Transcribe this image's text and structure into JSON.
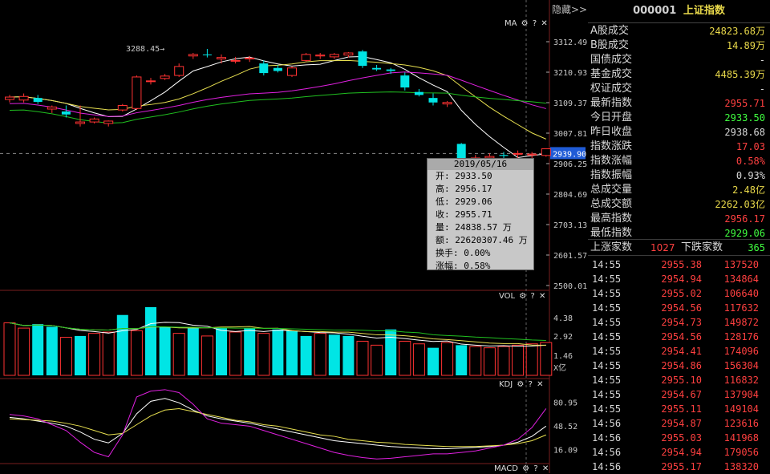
{
  "header": {
    "code": "000001",
    "name": "上证指数",
    "hide_label": "隐藏>>"
  },
  "ma_panel": {
    "label": "MA",
    "gear": "gear-icon",
    "help": "?",
    "close": "✕",
    "high_marker": "3288.45→",
    "price_ticks": [
      "3312.49",
      "3210.93",
      "3109.37",
      "3007.81",
      "2906.25",
      "2804.69",
      "2703.13",
      "2601.57",
      "2500.01"
    ],
    "current_price": "2939.90"
  },
  "vol_panel": {
    "label": "VOL",
    "ticks": [
      "4.38",
      "2.92",
      "1.46",
      "X亿"
    ]
  },
  "kdj_panel": {
    "label": "KDJ",
    "ticks": [
      "80.95",
      "48.52",
      "16.09"
    ]
  },
  "macd_panel": {
    "label": "MACD"
  },
  "tooltip": {
    "date": "2019/05/16",
    "lines": [
      "开: 2933.50",
      "高: 2956.17",
      "低: 2929.06",
      "收: 2955.71",
      "量: 24838.57 万",
      "额: 22620307.46 万",
      "换手: 0.00%",
      "涨幅: 0.58%"
    ]
  },
  "stats": [
    {
      "label": "A股成交",
      "value": "24823.68万",
      "color": "#e8d84a"
    },
    {
      "label": "B股成交",
      "value": "14.89万",
      "color": "#e8d84a"
    },
    {
      "label": "国债成交",
      "value": "-",
      "color": "#d8d8d8"
    },
    {
      "label": "基金成交",
      "value": "4485.39万",
      "color": "#e8d84a"
    },
    {
      "label": "权证成交",
      "value": "-",
      "color": "#d8d8d8"
    },
    {
      "label": "最新指数",
      "value": "2955.71",
      "color": "#ff4040"
    },
    {
      "label": "今日开盘",
      "value": "2933.50",
      "color": "#40ff40"
    },
    {
      "label": "昨日收盘",
      "value": "2938.68",
      "color": "#d8d8d8"
    },
    {
      "label": "指数涨跌",
      "value": "17.03",
      "color": "#ff4040"
    },
    {
      "label": "指数涨幅",
      "value": "0.58%",
      "color": "#ff4040"
    },
    {
      "label": "指数振幅",
      "value": "0.93%",
      "color": "#d8d8d8"
    },
    {
      "label": "总成交量",
      "value": "2.48亿",
      "color": "#e8d84a"
    },
    {
      "label": "总成交额",
      "value": "2262.03亿",
      "color": "#e8d84a"
    },
    {
      "label": "最高指数",
      "value": "2956.17",
      "color": "#ff4040"
    },
    {
      "label": "最低指数",
      "value": "2929.06",
      "color": "#40ff40"
    }
  ],
  "breadth": {
    "up_label": "上涨家数",
    "up": "1027",
    "down_label": "下跌家数",
    "down": "365"
  },
  "ticks": [
    {
      "t": "14:55",
      "p": "2955.38",
      "v": "137520"
    },
    {
      "t": "14:55",
      "p": "2954.94",
      "v": "134864"
    },
    {
      "t": "14:55",
      "p": "2955.02",
      "v": "106640"
    },
    {
      "t": "14:55",
      "p": "2954.56",
      "v": "117632"
    },
    {
      "t": "14:55",
      "p": "2954.73",
      "v": "149872"
    },
    {
      "t": "14:55",
      "p": "2954.56",
      "v": "128176"
    },
    {
      "t": "14:55",
      "p": "2954.41",
      "v": "174096"
    },
    {
      "t": "14:55",
      "p": "2954.86",
      "v": "156304"
    },
    {
      "t": "14:55",
      "p": "2955.10",
      "v": "116832"
    },
    {
      "t": "14:55",
      "p": "2954.67",
      "v": "137904"
    },
    {
      "t": "14:55",
      "p": "2955.11",
      "v": "149104"
    },
    {
      "t": "14:56",
      "p": "2954.87",
      "v": "123616"
    },
    {
      "t": "14:56",
      "p": "2955.03",
      "v": "141968"
    },
    {
      "t": "14:56",
      "p": "2954.94",
      "v": "179056"
    },
    {
      "t": "14:56",
      "p": "2955.17",
      "v": "138320"
    }
  ],
  "chart_data": {
    "type": "candlestick",
    "y_range": [
      2500.01,
      3312.49
    ],
    "candles": [
      {
        "o": 3120,
        "h": 3135,
        "l": 3110,
        "c": 3128
      },
      {
        "o": 3118,
        "h": 3140,
        "l": 3110,
        "c": 3130
      },
      {
        "o": 3125,
        "h": 3135,
        "l": 3105,
        "c": 3112
      },
      {
        "o": 3088,
        "h": 3100,
        "l": 3075,
        "c": 3095
      },
      {
        "o": 3080,
        "h": 3100,
        "l": 3060,
        "c": 3070
      },
      {
        "o": 3040,
        "h": 3100,
        "l": 3030,
        "c": 3045
      },
      {
        "o": 3045,
        "h": 3060,
        "l": 3040,
        "c": 3055
      },
      {
        "o": 3040,
        "h": 3050,
        "l": 3030,
        "c": 3048
      },
      {
        "o": 3085,
        "h": 3105,
        "l": 3080,
        "c": 3100
      },
      {
        "o": 3090,
        "h": 3200,
        "l": 3085,
        "c": 3195
      },
      {
        "o": 3180,
        "h": 3192,
        "l": 3170,
        "c": 3182
      },
      {
        "o": 3190,
        "h": 3205,
        "l": 3185,
        "c": 3198
      },
      {
        "o": 3200,
        "h": 3240,
        "l": 3195,
        "c": 3230
      },
      {
        "o": 3265,
        "h": 3275,
        "l": 3255,
        "c": 3270
      },
      {
        "o": 3270,
        "h": 3288.45,
        "l": 3260,
        "c": 3268
      },
      {
        "o": 3255,
        "h": 3270,
        "l": 3240,
        "c": 3260
      },
      {
        "o": 3250,
        "h": 3262,
        "l": 3240,
        "c": 3250
      },
      {
        "o": 3255,
        "h": 3265,
        "l": 3245,
        "c": 3258
      },
      {
        "o": 3240,
        "h": 3250,
        "l": 3200,
        "c": 3208
      },
      {
        "o": 3225,
        "h": 3235,
        "l": 3210,
        "c": 3215
      },
      {
        "o": 3200,
        "h": 3230,
        "l": 3195,
        "c": 3225
      },
      {
        "o": 3250,
        "h": 3275,
        "l": 3245,
        "c": 3270
      },
      {
        "o": 3265,
        "h": 3275,
        "l": 3255,
        "c": 3268
      },
      {
        "o": 3262,
        "h": 3275,
        "l": 3255,
        "c": 3270
      },
      {
        "o": 3268,
        "h": 3278,
        "l": 3260,
        "c": 3275
      },
      {
        "o": 3280,
        "h": 3285,
        "l": 3225,
        "c": 3232
      },
      {
        "o": 3225,
        "h": 3235,
        "l": 3215,
        "c": 3220
      },
      {
        "o": 3220,
        "h": 3225,
        "l": 3205,
        "c": 3215
      },
      {
        "o": 3200,
        "h": 3210,
        "l": 3150,
        "c": 3160
      },
      {
        "o": 3145,
        "h": 3155,
        "l": 3130,
        "c": 3135
      },
      {
        "o": 3125,
        "h": 3140,
        "l": 3100,
        "c": 3110
      },
      {
        "o": 3105,
        "h": 3115,
        "l": 3095,
        "c": 3110
      },
      {
        "o": 2972,
        "h": 2975,
        "l": 2880,
        "c": 2905
      },
      {
        "o": 2920,
        "h": 2935,
        "l": 2910,
        "c": 2925
      },
      {
        "o": 2925,
        "h": 2940,
        "l": 2918,
        "c": 2930
      },
      {
        "o": 2935,
        "h": 2945,
        "l": 2920,
        "c": 2932
      },
      {
        "o": 2938,
        "h": 2950,
        "l": 2925,
        "c": 2940
      },
      {
        "o": 2935,
        "h": 2945,
        "l": 2925,
        "c": 2938
      },
      {
        "o": 2933.5,
        "h": 2956.17,
        "l": 2929.06,
        "c": 2955.71
      }
    ],
    "volume": [
      {
        "v": 4.0,
        "up": true
      },
      {
        "v": 3.6,
        "up": true
      },
      {
        "v": 3.9,
        "up": false
      },
      {
        "v": 3.7,
        "up": false
      },
      {
        "v": 2.9,
        "up": true
      },
      {
        "v": 3.0,
        "up": false
      },
      {
        "v": 3.2,
        "up": true
      },
      {
        "v": 3.3,
        "up": true
      },
      {
        "v": 4.6,
        "up": false
      },
      {
        "v": 3.4,
        "up": true
      },
      {
        "v": 5.2,
        "up": false
      },
      {
        "v": 3.7,
        "up": false
      },
      {
        "v": 3.2,
        "up": true
      },
      {
        "v": 3.6,
        "up": false
      },
      {
        "v": 3.0,
        "up": true
      },
      {
        "v": 3.6,
        "up": false
      },
      {
        "v": 3.3,
        "up": true
      },
      {
        "v": 3.6,
        "up": false
      },
      {
        "v": 3.2,
        "up": true
      },
      {
        "v": 3.5,
        "up": false
      },
      {
        "v": 3.4,
        "up": false
      },
      {
        "v": 3.0,
        "up": false
      },
      {
        "v": 3.2,
        "up": true
      },
      {
        "v": 3.1,
        "up": false
      },
      {
        "v": 3.0,
        "up": false
      },
      {
        "v": 2.6,
        "up": true
      },
      {
        "v": 2.3,
        "up": true
      },
      {
        "v": 3.5,
        "up": false
      },
      {
        "v": 2.6,
        "up": true
      },
      {
        "v": 2.4,
        "up": true
      },
      {
        "v": 2.1,
        "up": false
      },
      {
        "v": 2.5,
        "up": true
      },
      {
        "v": 2.3,
        "up": false
      },
      {
        "v": 2.2,
        "up": true
      },
      {
        "v": 2.1,
        "up": true
      },
      {
        "v": 2.2,
        "up": true
      },
      {
        "v": 2.3,
        "up": true
      },
      {
        "v": 2.4,
        "up": true
      },
      {
        "v": 2.5,
        "up": true
      }
    ],
    "kdj": {
      "k": [
        60,
        58,
        55,
        52,
        48,
        40,
        30,
        25,
        38,
        65,
        82,
        86,
        80,
        70,
        62,
        58,
        55,
        52,
        48,
        44,
        40,
        36,
        32,
        28,
        26,
        24,
        22,
        20,
        19,
        18,
        17,
        17,
        18,
        19,
        20,
        22,
        26,
        34,
        48
      ],
      "d": [
        58,
        57,
        56,
        55,
        52,
        48,
        42,
        36,
        38,
        50,
        62,
        70,
        72,
        68,
        64,
        60,
        56,
        54,
        50,
        48,
        44,
        40,
        36,
        34,
        30,
        28,
        26,
        25,
        23,
        22,
        21,
        20,
        20,
        20,
        21,
        22,
        24,
        28,
        36
      ],
      "j": [
        64,
        62,
        58,
        50,
        42,
        26,
        12,
        6,
        36,
        88,
        96,
        98,
        94,
        78,
        58,
        52,
        50,
        48,
        42,
        36,
        30,
        24,
        18,
        12,
        8,
        5,
        3,
        4,
        6,
        8,
        10,
        10,
        12,
        14,
        18,
        22,
        30,
        46,
        72
      ]
    }
  }
}
